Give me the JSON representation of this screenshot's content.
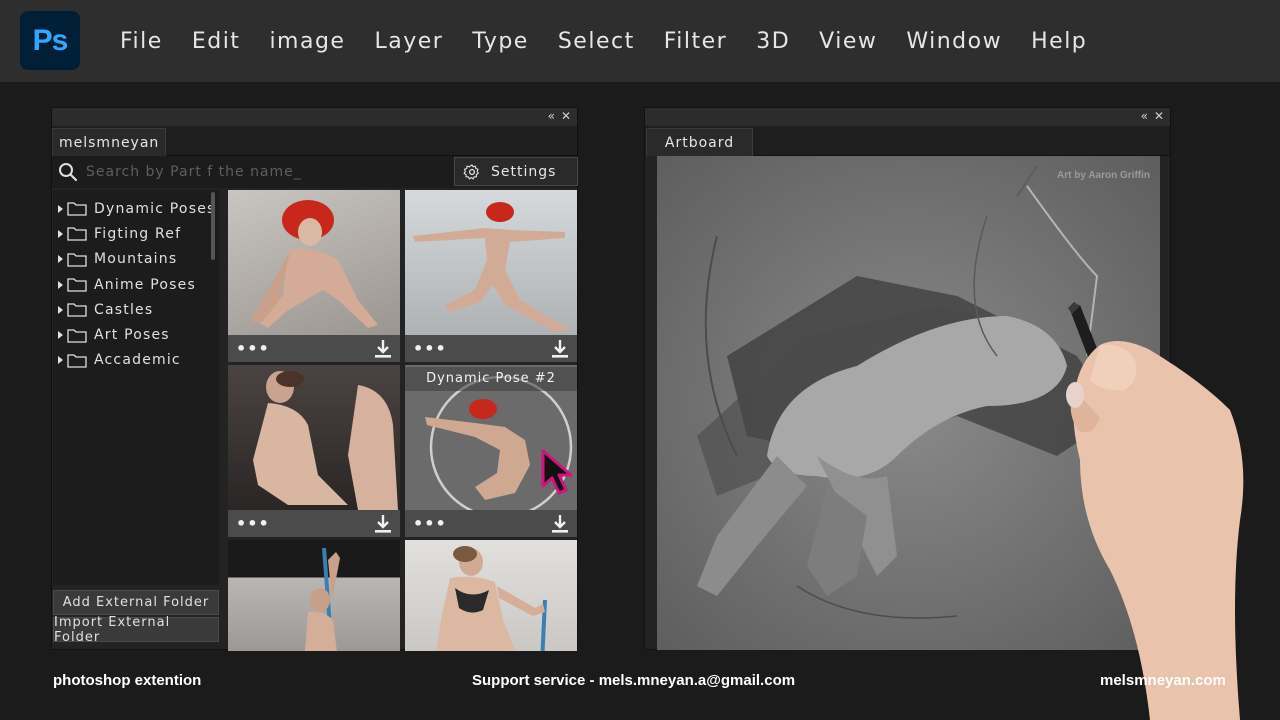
{
  "app": {
    "logo_text": "Ps"
  },
  "menu": [
    "File",
    "Edit",
    "image",
    "Layer",
    "Type",
    "Select",
    "Filter",
    "3D",
    "View",
    "Window",
    "Help"
  ],
  "library": {
    "user_tab": "melsmneyan",
    "search": {
      "placeholder": "Search by Part f the name_"
    },
    "settings_label": "Settings",
    "folders": [
      "Dynamic Poses",
      "Figting Ref",
      "Mountains",
      "Anime Poses",
      "Castles",
      "Art Poses",
      "Accademic"
    ],
    "add_folder_label": "Add External Folder",
    "import_folder_label": "Import External Folder",
    "hover_label": "Dynamic Pose #2",
    "more_glyph": "•••"
  },
  "artboard": {
    "tab_label": "Artboard",
    "credit": "Art by Aaron Griffin"
  },
  "footer": {
    "left": "photoshop extention",
    "center": "Support service - mels.mneyan.a@gmail.com",
    "right": "melsmneyan.com"
  },
  "colors": {
    "ps_blue": "#31a8ff",
    "ps_bg": "#001e36",
    "cursor_magenta": "#d4127e"
  }
}
